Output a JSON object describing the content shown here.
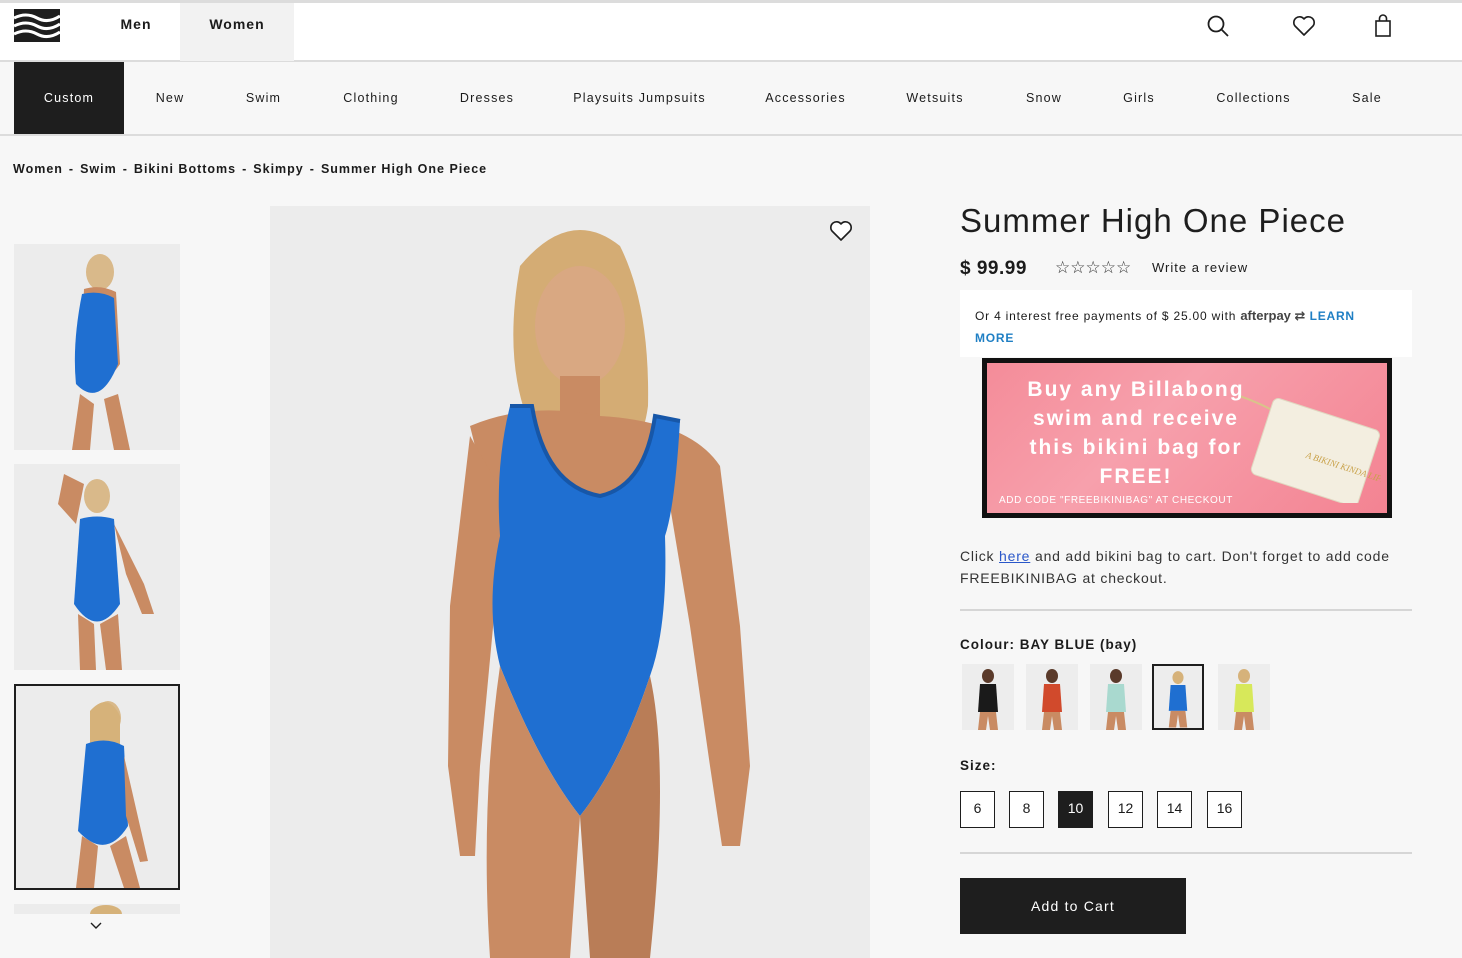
{
  "header": {
    "tabs": [
      {
        "label": "Men"
      },
      {
        "label": "Women"
      }
    ],
    "icons": [
      "search-icon",
      "heart-icon",
      "bag-icon"
    ]
  },
  "nav": {
    "items": [
      {
        "label": "Custom"
      },
      {
        "label": "New"
      },
      {
        "label": "Swim"
      },
      {
        "label": "Clothing"
      },
      {
        "label": "Dresses"
      },
      {
        "label": "Playsuits Jumpsuits"
      },
      {
        "label": "Accessories"
      },
      {
        "label": "Wetsuits"
      },
      {
        "label": "Snow"
      },
      {
        "label": "Girls"
      },
      {
        "label": "Collections"
      },
      {
        "label": "Sale"
      }
    ]
  },
  "breadcrumb": {
    "items": [
      "Women",
      "Swim",
      "Bikini Bottoms",
      "Skimpy",
      "Summer High One Piece"
    ],
    "separator": "-"
  },
  "product": {
    "title": "Summer High One Piece",
    "price": "$ 99.99",
    "stars": "☆☆☆☆☆",
    "review_link": "Write a review",
    "afterpay": {
      "text": "Or 4 interest free payments of $ 25.00 with",
      "logo": "afterpay",
      "learn_more": "LEARN MORE"
    },
    "promo": {
      "headline": "Buy any Billabong swim and receive this bikini bag for FREE!",
      "code_line": "ADD CODE \"FREEBIKINIBAG\" AT CHECKOUT",
      "bag_text": "A BIKINI KINDA LIFE"
    },
    "info": {
      "prefix": "Click",
      "link": "here",
      "suffix": "and add bikini bag to cart. Don't forget to add code FREEBIKINIBAG at checkout."
    },
    "colour_label": "Colour: BAY BLUE (bay)",
    "colours": [
      {
        "name": "black",
        "hex": "#1a1a1a"
      },
      {
        "name": "red",
        "hex": "#d14a2c"
      },
      {
        "name": "mint",
        "hex": "#a9d9cf"
      },
      {
        "name": "bay blue",
        "hex": "#1f6fd1"
      },
      {
        "name": "lime",
        "hex": "#d7e85a"
      }
    ],
    "selected_colour": 3,
    "size_label": "Size:",
    "sizes": [
      "6",
      "8",
      "10",
      "12",
      "14",
      "16"
    ],
    "selected_size": "10",
    "add_to_cart": "Add to Cart"
  },
  "colors": {
    "dark": "#1e1e1e",
    "swim_blue": "#1f6fd1",
    "afterpay_link": "#1f7fc4",
    "promo_pink": "#f48c99"
  }
}
